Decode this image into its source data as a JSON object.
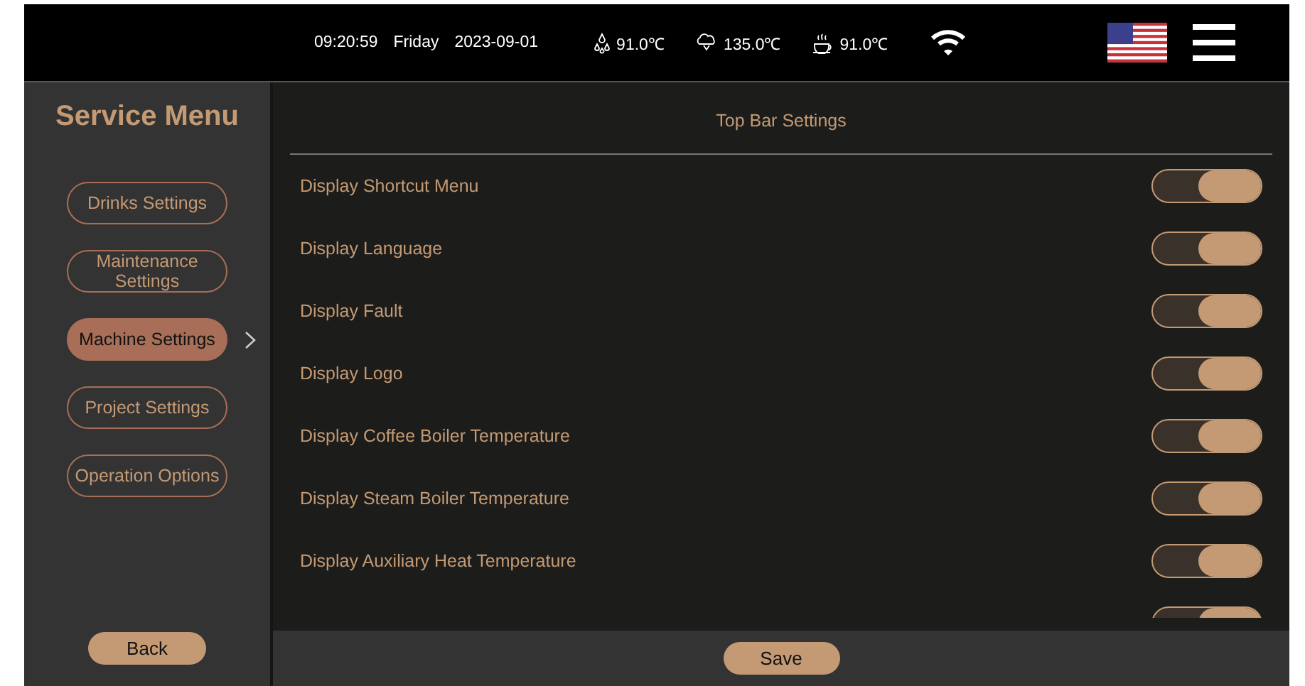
{
  "status_bar": {
    "time": "09:20:59",
    "day": "Friday",
    "date": "2023-09-01",
    "temperatures": [
      {
        "kind": "water",
        "value": "91.0℃"
      },
      {
        "kind": "steam",
        "value": "135.0℃"
      },
      {
        "kind": "cup",
        "value": "91.0℃"
      }
    ]
  },
  "sidebar": {
    "title": "Service Menu",
    "items": [
      {
        "label": "Drinks Settings",
        "selected": false
      },
      {
        "label": "Maintenance Settings",
        "selected": false
      },
      {
        "label": "Machine Settings",
        "selected": true
      },
      {
        "label": "Project Settings",
        "selected": false
      },
      {
        "label": "Operation Options",
        "selected": false
      }
    ],
    "back_button": "Back"
  },
  "panel": {
    "title": "Top Bar Settings",
    "rows": [
      {
        "label": "Display Shortcut Menu",
        "on": true
      },
      {
        "label": "Display Language",
        "on": true
      },
      {
        "label": "Display Fault",
        "on": true
      },
      {
        "label": "Display Logo",
        "on": true
      },
      {
        "label": "Display Coffee Boiler Temperature",
        "on": true
      },
      {
        "label": "Display Steam Boiler Temperature",
        "on": true
      },
      {
        "label": "Display Auxiliary Heat Temperature",
        "on": true
      },
      {
        "on": true
      }
    ],
    "save_button": "Save"
  }
}
